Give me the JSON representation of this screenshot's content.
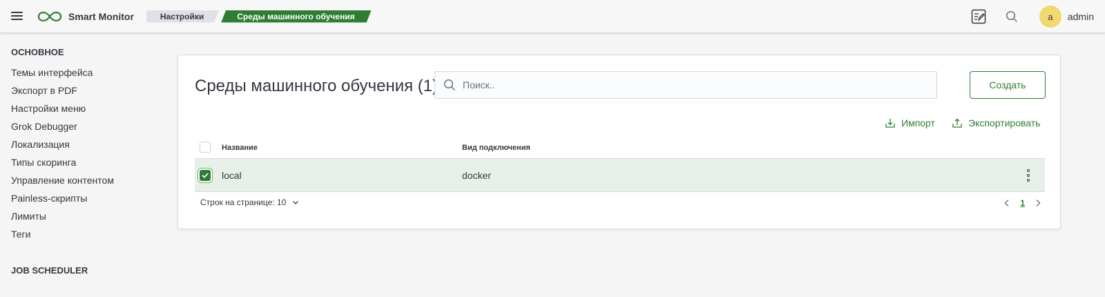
{
  "header": {
    "app_name": "Smart Monitor",
    "breadcrumbs": [
      "Настройки",
      "Среды машинного обучения"
    ],
    "user": {
      "avatar_letter": "a",
      "name": "admin"
    }
  },
  "sidebar": {
    "sections": [
      {
        "title": "ОСНОВНОЕ",
        "items": [
          "Темы интерфейса",
          "Экспорт в PDF",
          "Настройки меню",
          "Grok Debugger",
          "Локализация",
          "Типы скоринга",
          "Управление контентом",
          "Painless-скрипты",
          "Лимиты",
          "Теги"
        ]
      },
      {
        "title": "JOB SCHEDULER",
        "items": []
      }
    ]
  },
  "main": {
    "title": "Среды машинного обучения (1)",
    "search_placeholder": "Поиск..",
    "create_label": "Создать",
    "import_label": "Импорт",
    "export_label": "Экспортировать",
    "columns": [
      "Название",
      "Вид подключения"
    ],
    "rows": [
      {
        "name": "local",
        "connection": "docker",
        "selected": true
      }
    ],
    "rows_per_page_label": "Строк на странице: 10",
    "current_page": "1"
  },
  "colors": {
    "accent": "#2e7d32",
    "selected_row": "#e8efe9",
    "avatar": "#f1d86f"
  }
}
